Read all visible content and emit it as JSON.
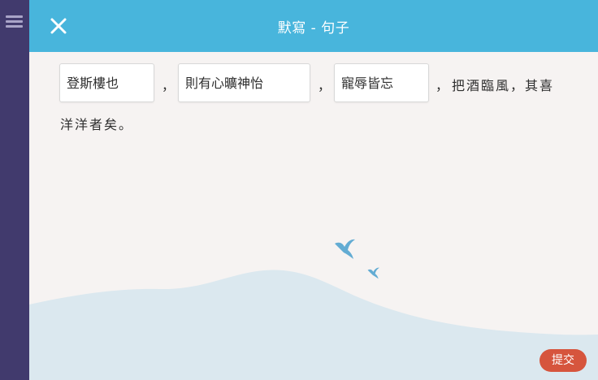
{
  "header": {
    "title": "默寫 - 句子",
    "color": "#48b5dc"
  },
  "sidebar": {
    "color": "#413a6d",
    "menu_icon": "hamburger-menu-icon"
  },
  "close_icon": "close-icon",
  "exercise": {
    "answers": [
      "登斯樓也",
      "則有心曠神怡",
      "寵辱皆忘"
    ],
    "separators": [
      "，",
      "，",
      "，"
    ],
    "continuation_line1": "把酒臨風，其喜",
    "continuation_line2": "洋洋者矣。"
  },
  "submit": {
    "label": "提交",
    "color": "#d6553d"
  }
}
